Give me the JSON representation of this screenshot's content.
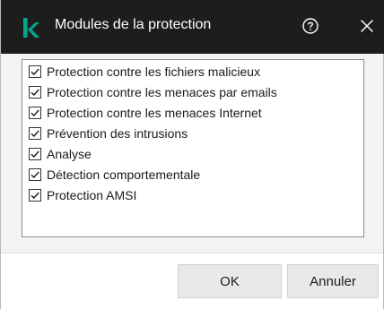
{
  "window": {
    "title": "Modules de la protection",
    "app_icon": "kaspersky-k-logo",
    "help_icon": "help-circle-icon",
    "close_icon": "close-icon",
    "accent_color": "#00a88e",
    "titlebar_color": "#1d1d1d"
  },
  "modules": [
    {
      "label": "Protection contre les fichiers malicieux",
      "checked": true
    },
    {
      "label": "Protection contre les menaces par emails",
      "checked": true
    },
    {
      "label": "Protection contre les menaces Internet",
      "checked": true
    },
    {
      "label": "Prévention des intrusions",
      "checked": true
    },
    {
      "label": "Analyse",
      "checked": true
    },
    {
      "label": "Détection comportementale",
      "checked": true
    },
    {
      "label": "Protection AMSI",
      "checked": true
    }
  ],
  "footer": {
    "ok_label": "OK",
    "cancel_label": "Annuler"
  }
}
